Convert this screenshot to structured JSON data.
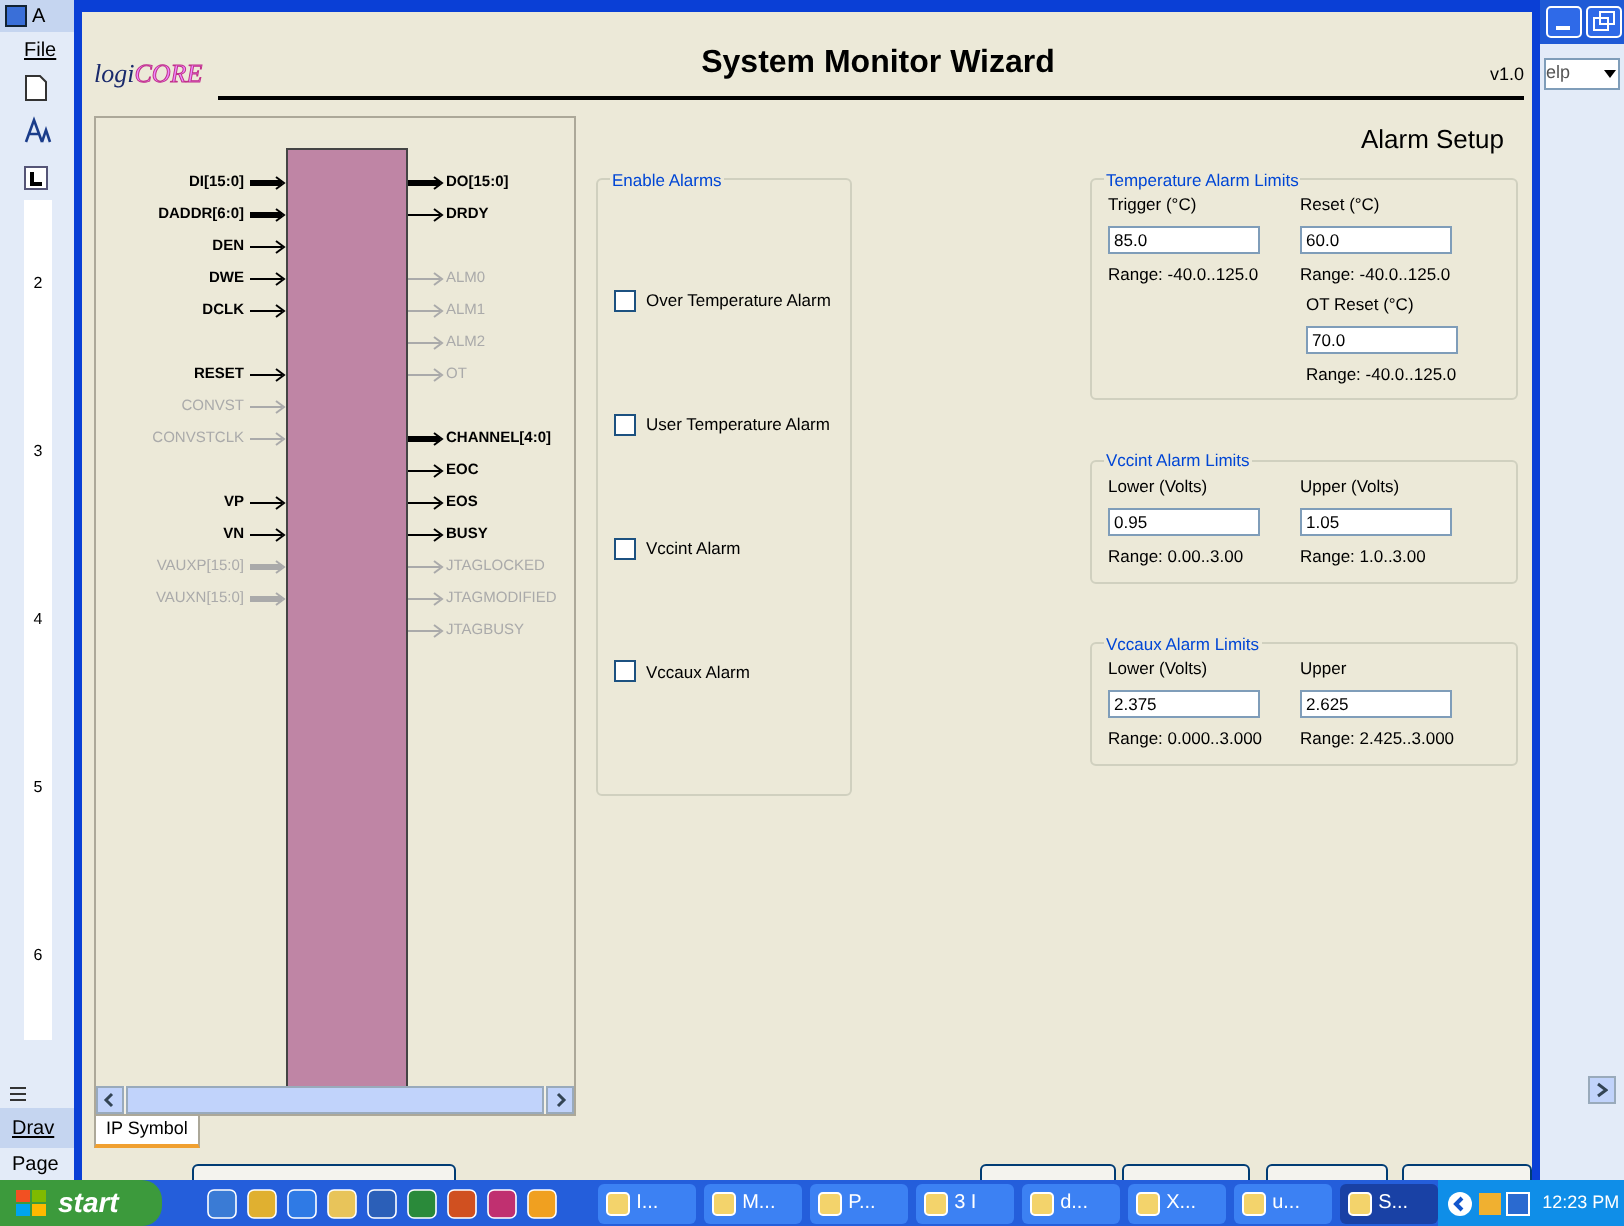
{
  "background_window": {
    "title_partial": "A",
    "menu_partial": "File",
    "help_partial": "elp",
    "ruler_numbers": [
      "2",
      "3",
      "4",
      "5",
      "6"
    ],
    "draw_partial": "Drav",
    "page_partial": "Page"
  },
  "wizard": {
    "logo_prefix": "logi",
    "logo_suffix": "CORE",
    "title": "System Monitor Wizard",
    "version": "v1.0",
    "page_title": "Alarm Setup",
    "symbol_rows": [
      {
        "left": {
          "label": "DI[15:0]",
          "bus": true,
          "enabled": true
        },
        "right": {
          "label": "DO[15:0]",
          "bus": true,
          "enabled": true
        }
      },
      {
        "left": {
          "label": "DADDR[6:0]",
          "bus": true,
          "enabled": true
        },
        "right": {
          "label": "DRDY",
          "bus": false,
          "enabled": true
        }
      },
      {
        "left": {
          "label": "DEN",
          "bus": false,
          "enabled": true
        }
      },
      {
        "left": {
          "label": "DWE",
          "bus": false,
          "enabled": true
        },
        "right": {
          "label": "ALM0",
          "bus": false,
          "enabled": false
        }
      },
      {
        "left": {
          "label": "DCLK",
          "bus": false,
          "enabled": true
        },
        "right": {
          "label": "ALM1",
          "bus": false,
          "enabled": false
        }
      },
      {
        "right": {
          "label": "ALM2",
          "bus": false,
          "enabled": false
        }
      },
      {
        "left": {
          "label": "RESET",
          "bus": false,
          "enabled": true
        },
        "right": {
          "label": "OT",
          "bus": false,
          "enabled": false
        }
      },
      {
        "left": {
          "label": "CONVST",
          "bus": false,
          "enabled": false
        }
      },
      {
        "left": {
          "label": "CONVSTCLK",
          "bus": false,
          "enabled": false
        },
        "right": {
          "label": "CHANNEL[4:0]",
          "bus": true,
          "enabled": true
        }
      },
      {
        "right": {
          "label": "EOC",
          "bus": false,
          "enabled": true
        }
      },
      {
        "left": {
          "label": "VP",
          "bus": false,
          "enabled": true
        },
        "right": {
          "label": "EOS",
          "bus": false,
          "enabled": true
        }
      },
      {
        "left": {
          "label": "VN",
          "bus": false,
          "enabled": true
        },
        "right": {
          "label": "BUSY",
          "bus": false,
          "enabled": true
        }
      },
      {
        "left": {
          "label": "VAUXP[15:0]",
          "bus": true,
          "enabled": false
        },
        "right": {
          "label": "JTAGLOCKED",
          "bus": false,
          "enabled": false
        }
      },
      {
        "left": {
          "label": "VAUXN[15:0]",
          "bus": true,
          "enabled": false
        },
        "right": {
          "label": "JTAGMODIFIED",
          "bus": false,
          "enabled": false
        }
      },
      {
        "right": {
          "label": "JTAGBUSY",
          "bus": false,
          "enabled": false
        }
      }
    ],
    "symbol_tab": {
      "label": "IP Symbol",
      "selected": true
    },
    "enable_alarms": {
      "title": "Enable Alarms",
      "items": [
        {
          "label": "Over Temperature Alarm",
          "checked": false
        },
        {
          "label": "User Temperature Alarm",
          "checked": false
        },
        {
          "label": "Vccint Alarm",
          "checked": false
        },
        {
          "label": "Vccaux Alarm",
          "checked": false
        }
      ]
    },
    "limit_groups": [
      {
        "title": "Temperature Alarm Limits",
        "fields": [
          {
            "label": "Trigger (°C)",
            "value": "85.0",
            "range": "Range: -40.0..125.0"
          },
          {
            "label": "Reset (°C)",
            "value": "60.0",
            "range": "Range: -40.0..125.0"
          },
          {
            "label": "OT Reset (°C)",
            "value": "70.0",
            "range": "Range: -40.0..125.0"
          }
        ]
      },
      {
        "title": "Vccint Alarm Limits",
        "fields": [
          {
            "label": "Lower (Volts)",
            "value": "0.95",
            "range": "Range: 0.00..3.00"
          },
          {
            "label": "Upper (Volts)",
            "value": "1.05",
            "range": "Range: 1.0..3.00"
          }
        ]
      },
      {
        "title": "Vccaux Alarm Limits",
        "fields": [
          {
            "label": "Lower (Volts)",
            "value": "2.375",
            "range": "Range: 0.000..3.000"
          },
          {
            "label": "Upper",
            "value": "2.625",
            "range": "Range: 2.425..3.000"
          }
        ]
      }
    ]
  },
  "taskbar": {
    "start": "start",
    "tasks": [
      {
        "label": "I...",
        "selected": false
      },
      {
        "label": "M...",
        "selected": false
      },
      {
        "label": "P...",
        "selected": false
      },
      {
        "label": "3 I",
        "selected": false
      },
      {
        "label": "d...",
        "selected": false
      },
      {
        "label": "X...",
        "selected": false
      },
      {
        "label": "u...",
        "selected": false
      },
      {
        "label": "S...",
        "selected": true
      }
    ],
    "clock": "12:23 PM"
  }
}
